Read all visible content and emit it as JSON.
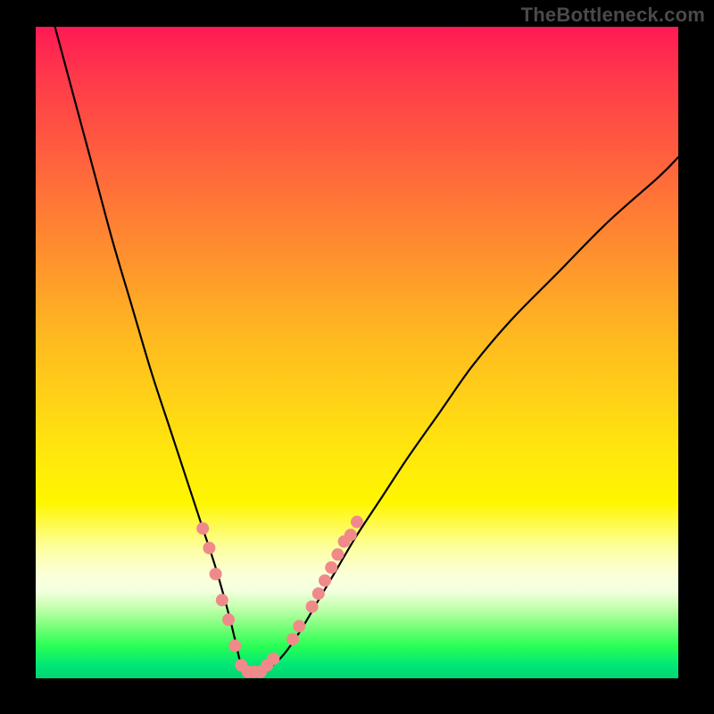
{
  "attribution": "TheBottleneck.com",
  "chart_data": {
    "type": "line",
    "title": "",
    "xlabel": "",
    "ylabel": "",
    "xlim": [
      0,
      100
    ],
    "ylim": [
      0,
      100
    ],
    "grid": false,
    "series": [
      {
        "name": "bottleneck-curve",
        "x": [
          3,
          6,
          9,
          12,
          15,
          18,
          21,
          24,
          26,
          28,
          30,
          31,
          32,
          33,
          35,
          38,
          41,
          44,
          47,
          50,
          54,
          58,
          63,
          68,
          74,
          81,
          89,
          97,
          100
        ],
        "y": [
          100,
          89,
          78,
          67,
          57,
          47,
          38,
          29,
          23,
          17,
          10,
          6,
          2,
          1,
          1,
          3,
          7,
          12,
          17,
          22,
          28,
          34,
          41,
          48,
          55,
          62,
          70,
          77,
          80
        ]
      }
    ],
    "highlight_points": {
      "name": "marker-dots",
      "color": "#f08a8a",
      "points": [
        {
          "x": 26,
          "y": 23
        },
        {
          "x": 27,
          "y": 20
        },
        {
          "x": 28,
          "y": 16
        },
        {
          "x": 29,
          "y": 12
        },
        {
          "x": 30,
          "y": 9
        },
        {
          "x": 31,
          "y": 5
        },
        {
          "x": 32,
          "y": 2
        },
        {
          "x": 33,
          "y": 1
        },
        {
          "x": 34,
          "y": 1
        },
        {
          "x": 35,
          "y": 1
        },
        {
          "x": 36,
          "y": 2
        },
        {
          "x": 37,
          "y": 3
        },
        {
          "x": 40,
          "y": 6
        },
        {
          "x": 41,
          "y": 8
        },
        {
          "x": 43,
          "y": 11
        },
        {
          "x": 44,
          "y": 13
        },
        {
          "x": 45,
          "y": 15
        },
        {
          "x": 46,
          "y": 17
        },
        {
          "x": 47,
          "y": 19
        },
        {
          "x": 48,
          "y": 21
        },
        {
          "x": 49,
          "y": 22
        },
        {
          "x": 50,
          "y": 24
        }
      ]
    },
    "gradient_stops": [
      {
        "pos": 0.0,
        "color": "#ff1a55"
      },
      {
        "pos": 0.38,
        "color": "#ff9a2b"
      },
      {
        "pos": 0.66,
        "color": "#ffe80c"
      },
      {
        "pos": 0.84,
        "color": "#fbffd8"
      },
      {
        "pos": 1.0,
        "color": "#00d470"
      }
    ]
  }
}
